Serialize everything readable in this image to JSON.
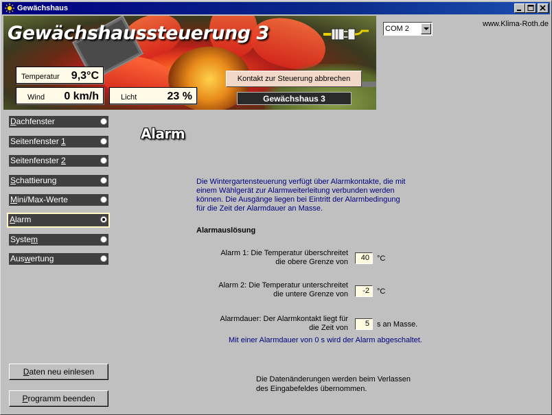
{
  "window": {
    "title": "Gewächshaus",
    "controls": [
      "minimize-icon",
      "maximize-icon",
      "close-icon"
    ]
  },
  "header": {
    "app_title": "Gewächshaussteuerung 3",
    "abort_button": "Kontakt zur Steuerung abbrechen",
    "device_name": "Gewächshaus 3",
    "com_port": "COM 2",
    "website": "www.Klima-Roth.de",
    "readouts": {
      "temperature": {
        "label": "Temperatur",
        "value": "9,3°C"
      },
      "wind": {
        "label": "Wind",
        "value": "0 km/h"
      },
      "light": {
        "label": "Licht",
        "value": "23 %"
      }
    }
  },
  "nav": {
    "items": [
      {
        "pre": "",
        "key": "D",
        "post": "achfenster"
      },
      {
        "pre": "Seitenfenster ",
        "key": "1",
        "post": ""
      },
      {
        "pre": "Seitenfenster ",
        "key": "2",
        "post": ""
      },
      {
        "pre": "",
        "key": "S",
        "post": "chattierung"
      },
      {
        "pre": "",
        "key": "M",
        "post": "ini/Max-Werte"
      },
      {
        "pre": "",
        "key": "A",
        "post": "larm"
      },
      {
        "pre": "Syste",
        "key": "m",
        "post": ""
      },
      {
        "pre": "Aus",
        "key": "w",
        "post": "ertung"
      }
    ],
    "selected": "Alarm"
  },
  "main": {
    "page_title": "Alarm",
    "description": "Die Wintergartensteuerung verfügt über Alarmkontakte, die mit einem Wählgerät zur Alarmweiterleitung verbunden werden können. Die Ausgänge liegen bei Eintritt der Alarmbedingung für die Zeit der Alarmdauer an Masse.",
    "section_title": "Alarmauslösung",
    "alarm1": {
      "line1": "Alarm 1: Die Temperatur überschreitet",
      "line2": "die obere Grenze von",
      "value": "40",
      "unit": "°C"
    },
    "alarm2": {
      "line1": "Alarm 2: Die Temperatur unterschreitet",
      "line2": "die untere Grenze von",
      "value": "-2",
      "unit": "°C"
    },
    "duration": {
      "line1": "Alarmdauer: Der Alarmkontakt liegt für",
      "line2": "die Zeit von",
      "value": "5",
      "unit": "s an Masse."
    },
    "hint": "Mit einer Alarmdauer von 0 s wird der Alarm abgeschaltet.",
    "footer_line1": "Die Datenänderungen werden beim Verlassen",
    "footer_line2": "des Eingabefeldes übernommen."
  },
  "buttons": {
    "reload": {
      "pre": "",
      "key": "D",
      "post": "aten neu einlesen"
    },
    "quit": {
      "pre": "",
      "key": "P",
      "post": "rogramm beenden"
    }
  },
  "colors": {
    "title_bar": "#000080",
    "nav_bg": "#404040",
    "info_text": "#000080",
    "field_bg": "#fffbe0"
  }
}
